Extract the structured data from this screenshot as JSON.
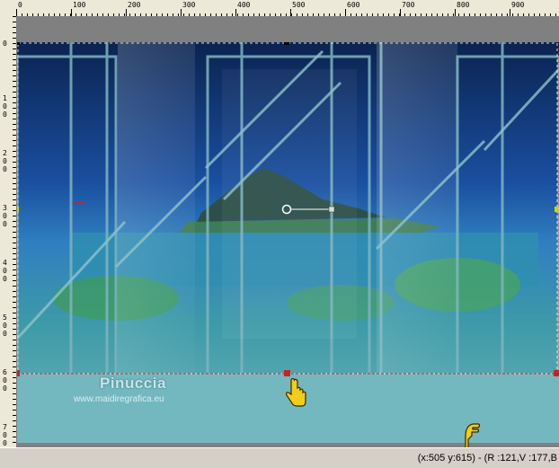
{
  "ruler": {
    "top_labels": [
      "0",
      "100",
      "200",
      "300",
      "400",
      "500",
      "600",
      "700",
      "800",
      "900"
    ],
    "left_labels": [
      "0",
      "1\n0\n0",
      "2\n0\n0",
      "3\n0\n0",
      "4\n0\n0",
      "5\n0\n0",
      "6\n0\n0",
      "7\n0\n0"
    ]
  },
  "watermark": {
    "name": "Pinuccia",
    "site": "www.maidiregrafica.eu"
  },
  "status": {
    "coords": "(x:505 y:615) - (R :121,V :177,B"
  },
  "icons": {
    "hand_cursor": "pointing-hand-icon",
    "pointer_hand": "pan-hand-icon"
  },
  "colors": {
    "selection": "#cc2222",
    "handle": "#000000",
    "guide_yellow": "#c8d800"
  }
}
